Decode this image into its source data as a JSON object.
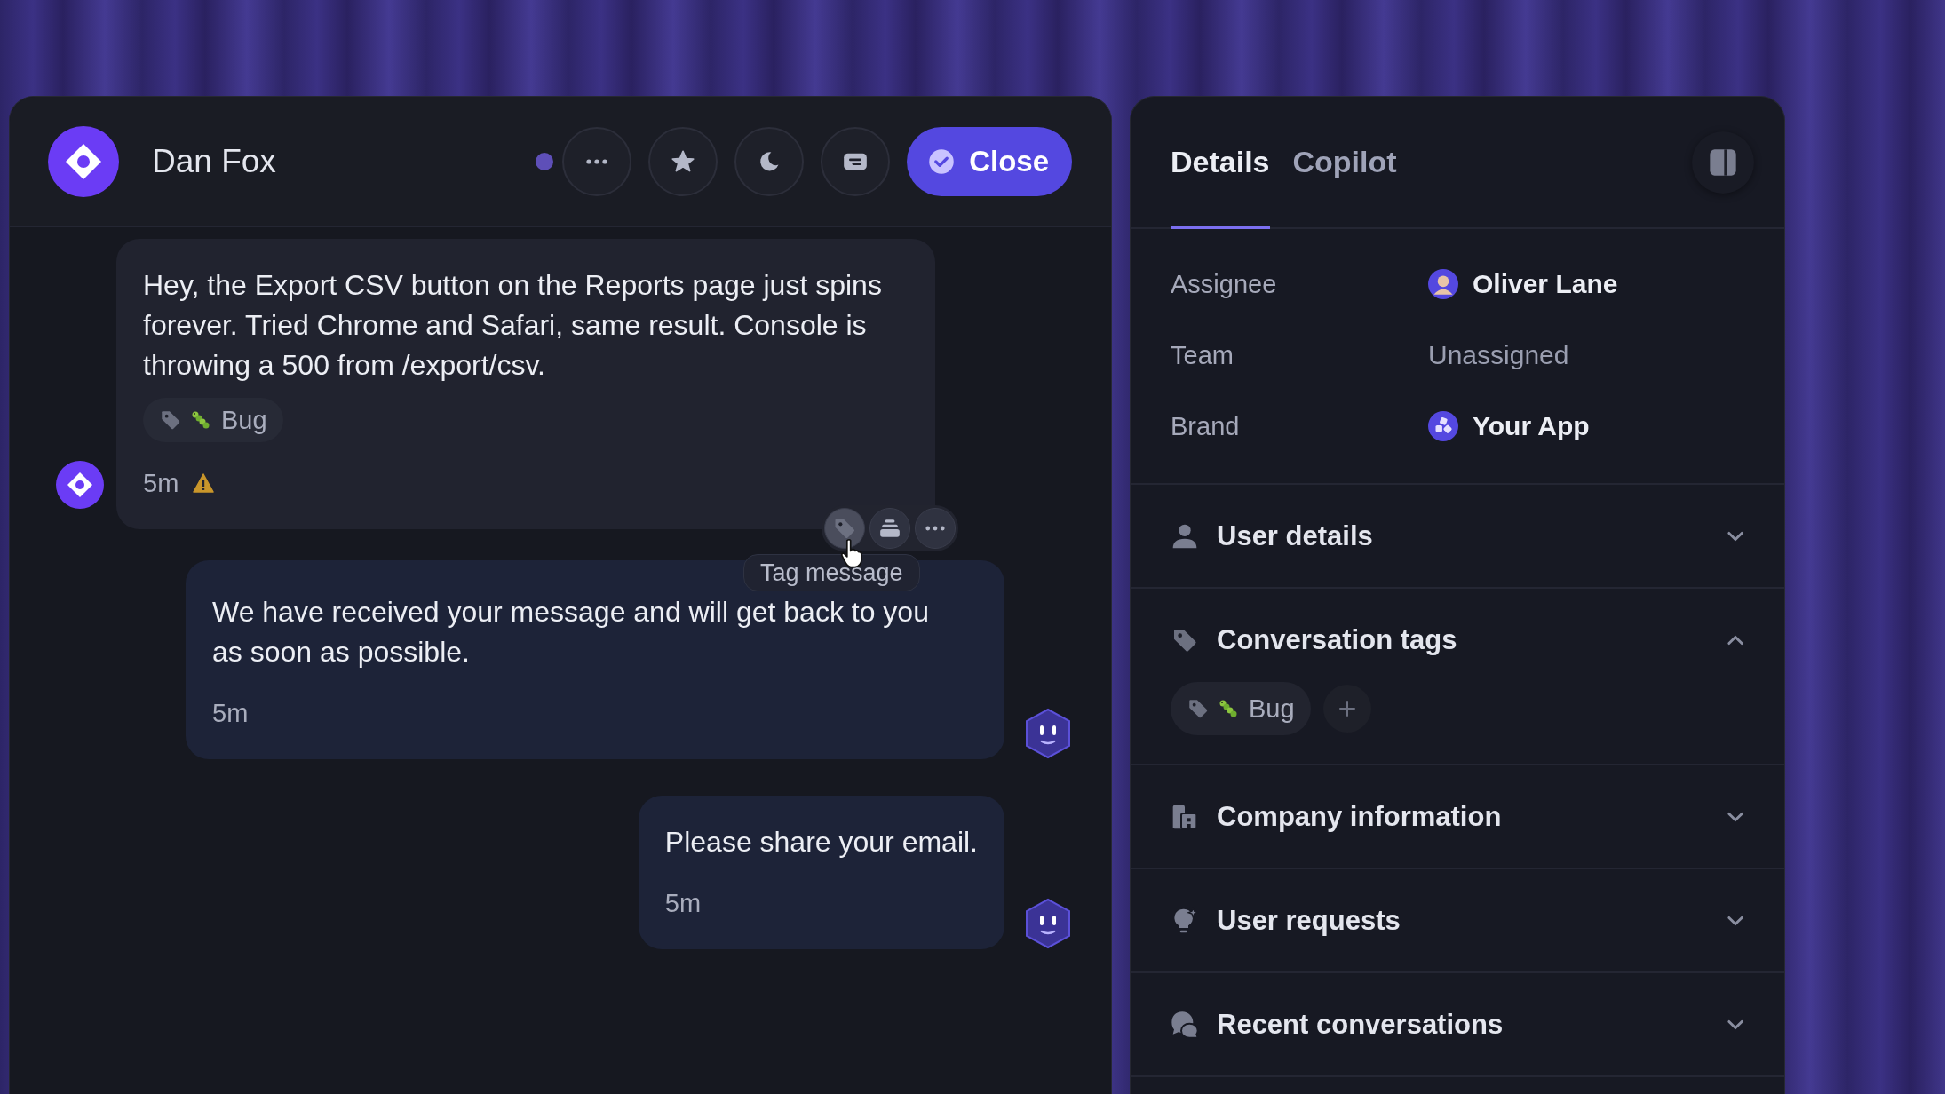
{
  "conversation": {
    "contact": "Dan Fox",
    "close_label": "Close"
  },
  "messages": [
    {
      "kind": "user",
      "text": "Hey, the Export CSV button on the Reports page just spins forever. Tried Chrome and Safari, same result. Console is throwing a 500 from /export/csv.",
      "tags": [
        {
          "label": "Bug"
        }
      ],
      "time": "5m",
      "warning": true,
      "tooltip": "Tag message"
    },
    {
      "kind": "bot",
      "text": "We have received your message and will get back to you as soon as possible.",
      "time": "5m",
      "warning": false
    },
    {
      "kind": "bot",
      "text": "Please share your email.",
      "time": "5m",
      "warning": false
    }
  ],
  "tabs": [
    {
      "label": "Details",
      "selected": true
    },
    {
      "label": "Copilot",
      "selected": false
    }
  ],
  "details": [
    {
      "label": "Assignee",
      "value": "Oliver Lane",
      "kind": "person"
    },
    {
      "label": "Team",
      "value": "Unassigned",
      "kind": "empty"
    },
    {
      "label": "Brand",
      "value": "Your App",
      "kind": "brand"
    }
  ],
  "sections": [
    {
      "title": "User details",
      "kind": "user",
      "expanded": false
    },
    {
      "title": "Conversation tags",
      "kind": "tags",
      "expanded": true,
      "tags": [
        {
          "label": "Bug"
        }
      ]
    },
    {
      "title": "Company information",
      "kind": "company",
      "expanded": false
    },
    {
      "title": "User requests",
      "kind": "requests",
      "expanded": false
    },
    {
      "title": "Recent conversations",
      "kind": "conversations",
      "expanded": false
    }
  ]
}
